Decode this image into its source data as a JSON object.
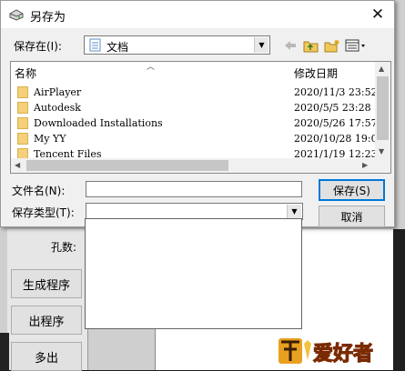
{
  "dialog": {
    "title": "另存为",
    "close_symbol": "✕",
    "save_in_label": "保存在(I):",
    "save_in_value": "文档",
    "columns": {
      "name": "名称",
      "modified": "修改日期"
    },
    "files": [
      {
        "name": "AirPlayer",
        "modified": "2020/11/3 23:52"
      },
      {
        "name": "Autodesk",
        "modified": "2020/5/5 23:28"
      },
      {
        "name": "Downloaded Installations",
        "modified": "2020/5/26 17:57"
      },
      {
        "name": "My YY",
        "modified": "2020/10/28 19:0"
      },
      {
        "name": "Tencent Files",
        "modified": "2021/1/19 12:23"
      }
    ],
    "filename_label": "文件名(N):",
    "filename_value": "",
    "filetype_label": "保存类型(T):",
    "filetype_value": "",
    "save_button": "保存(S)",
    "cancel_button": "取消",
    "icons": [
      "drive-icon",
      "folder-doc-icon",
      "back-arrow-icon",
      "up-folder-icon",
      "new-folder-icon",
      "view-menu-icon",
      "folder-icon"
    ]
  },
  "background_app": {
    "hole_count_label": "孔数:",
    "buttons": [
      "生成程序",
      "出程序",
      "多出"
    ]
  },
  "watermark": {
    "text": "爱好者"
  }
}
